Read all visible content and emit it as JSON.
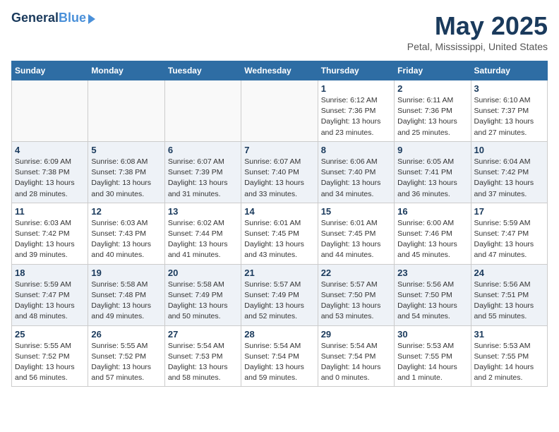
{
  "header": {
    "logo_line1": "General",
    "logo_line2": "Blue",
    "title": "May 2025",
    "location": "Petal, Mississippi, United States"
  },
  "weekdays": [
    "Sunday",
    "Monday",
    "Tuesday",
    "Wednesday",
    "Thursday",
    "Friday",
    "Saturday"
  ],
  "weeks": [
    [
      {
        "day": "",
        "info": ""
      },
      {
        "day": "",
        "info": ""
      },
      {
        "day": "",
        "info": ""
      },
      {
        "day": "",
        "info": ""
      },
      {
        "day": "1",
        "info": "Sunrise: 6:12 AM\nSunset: 7:36 PM\nDaylight: 13 hours\nand 23 minutes."
      },
      {
        "day": "2",
        "info": "Sunrise: 6:11 AM\nSunset: 7:36 PM\nDaylight: 13 hours\nand 25 minutes."
      },
      {
        "day": "3",
        "info": "Sunrise: 6:10 AM\nSunset: 7:37 PM\nDaylight: 13 hours\nand 27 minutes."
      }
    ],
    [
      {
        "day": "4",
        "info": "Sunrise: 6:09 AM\nSunset: 7:38 PM\nDaylight: 13 hours\nand 28 minutes."
      },
      {
        "day": "5",
        "info": "Sunrise: 6:08 AM\nSunset: 7:38 PM\nDaylight: 13 hours\nand 30 minutes."
      },
      {
        "day": "6",
        "info": "Sunrise: 6:07 AM\nSunset: 7:39 PM\nDaylight: 13 hours\nand 31 minutes."
      },
      {
        "day": "7",
        "info": "Sunrise: 6:07 AM\nSunset: 7:40 PM\nDaylight: 13 hours\nand 33 minutes."
      },
      {
        "day": "8",
        "info": "Sunrise: 6:06 AM\nSunset: 7:40 PM\nDaylight: 13 hours\nand 34 minutes."
      },
      {
        "day": "9",
        "info": "Sunrise: 6:05 AM\nSunset: 7:41 PM\nDaylight: 13 hours\nand 36 minutes."
      },
      {
        "day": "10",
        "info": "Sunrise: 6:04 AM\nSunset: 7:42 PM\nDaylight: 13 hours\nand 37 minutes."
      }
    ],
    [
      {
        "day": "11",
        "info": "Sunrise: 6:03 AM\nSunset: 7:42 PM\nDaylight: 13 hours\nand 39 minutes."
      },
      {
        "day": "12",
        "info": "Sunrise: 6:03 AM\nSunset: 7:43 PM\nDaylight: 13 hours\nand 40 minutes."
      },
      {
        "day": "13",
        "info": "Sunrise: 6:02 AM\nSunset: 7:44 PM\nDaylight: 13 hours\nand 41 minutes."
      },
      {
        "day": "14",
        "info": "Sunrise: 6:01 AM\nSunset: 7:45 PM\nDaylight: 13 hours\nand 43 minutes."
      },
      {
        "day": "15",
        "info": "Sunrise: 6:01 AM\nSunset: 7:45 PM\nDaylight: 13 hours\nand 44 minutes."
      },
      {
        "day": "16",
        "info": "Sunrise: 6:00 AM\nSunset: 7:46 PM\nDaylight: 13 hours\nand 45 minutes."
      },
      {
        "day": "17",
        "info": "Sunrise: 5:59 AM\nSunset: 7:47 PM\nDaylight: 13 hours\nand 47 minutes."
      }
    ],
    [
      {
        "day": "18",
        "info": "Sunrise: 5:59 AM\nSunset: 7:47 PM\nDaylight: 13 hours\nand 48 minutes."
      },
      {
        "day": "19",
        "info": "Sunrise: 5:58 AM\nSunset: 7:48 PM\nDaylight: 13 hours\nand 49 minutes."
      },
      {
        "day": "20",
        "info": "Sunrise: 5:58 AM\nSunset: 7:49 PM\nDaylight: 13 hours\nand 50 minutes."
      },
      {
        "day": "21",
        "info": "Sunrise: 5:57 AM\nSunset: 7:49 PM\nDaylight: 13 hours\nand 52 minutes."
      },
      {
        "day": "22",
        "info": "Sunrise: 5:57 AM\nSunset: 7:50 PM\nDaylight: 13 hours\nand 53 minutes."
      },
      {
        "day": "23",
        "info": "Sunrise: 5:56 AM\nSunset: 7:50 PM\nDaylight: 13 hours\nand 54 minutes."
      },
      {
        "day": "24",
        "info": "Sunrise: 5:56 AM\nSunset: 7:51 PM\nDaylight: 13 hours\nand 55 minutes."
      }
    ],
    [
      {
        "day": "25",
        "info": "Sunrise: 5:55 AM\nSunset: 7:52 PM\nDaylight: 13 hours\nand 56 minutes."
      },
      {
        "day": "26",
        "info": "Sunrise: 5:55 AM\nSunset: 7:52 PM\nDaylight: 13 hours\nand 57 minutes."
      },
      {
        "day": "27",
        "info": "Sunrise: 5:54 AM\nSunset: 7:53 PM\nDaylight: 13 hours\nand 58 minutes."
      },
      {
        "day": "28",
        "info": "Sunrise: 5:54 AM\nSunset: 7:54 PM\nDaylight: 13 hours\nand 59 minutes."
      },
      {
        "day": "29",
        "info": "Sunrise: 5:54 AM\nSunset: 7:54 PM\nDaylight: 14 hours\nand 0 minutes."
      },
      {
        "day": "30",
        "info": "Sunrise: 5:53 AM\nSunset: 7:55 PM\nDaylight: 14 hours\nand 1 minute."
      },
      {
        "day": "31",
        "info": "Sunrise: 5:53 AM\nSunset: 7:55 PM\nDaylight: 14 hours\nand 2 minutes."
      }
    ]
  ]
}
